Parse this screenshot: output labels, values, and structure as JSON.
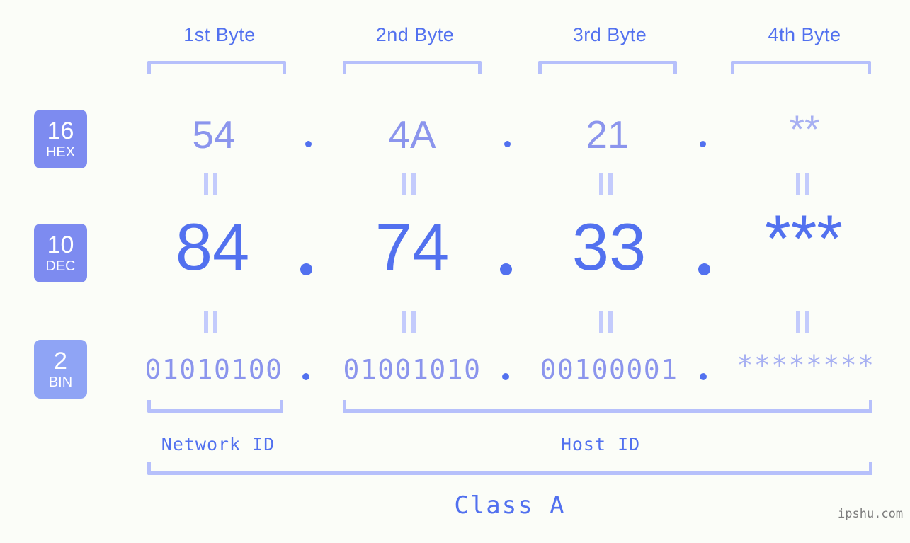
{
  "meta": {
    "background_color": "#fbfdf8",
    "accent_color": "#5271ef",
    "accent_light_color": "#8b95ed",
    "bracket_color": "#b6c0fb",
    "badge_color": "#7d8bf0",
    "badge_color_light": "#8fa4f5",
    "watermark": "ipshu.com"
  },
  "byte_headers": [
    {
      "label": "1st Byte"
    },
    {
      "label": "2nd Byte"
    },
    {
      "label": "3rd Byte"
    },
    {
      "label": "4th Byte"
    }
  ],
  "radix_badges": [
    {
      "number": "16",
      "name": "HEX"
    },
    {
      "number": "10",
      "name": "DEC"
    },
    {
      "number": "2",
      "name": "BIN"
    }
  ],
  "rows": {
    "hex": {
      "values": [
        "54",
        "4A",
        "21",
        "**"
      ],
      "separator": "."
    },
    "dec": {
      "values": [
        "84",
        "74",
        "33",
        "***"
      ],
      "separator": "."
    },
    "bin": {
      "values": [
        "01010100",
        "01001010",
        "00100001",
        "********"
      ],
      "separator": "."
    }
  },
  "equality_marker": "=",
  "id_sections": [
    {
      "label": "Network ID"
    },
    {
      "label": "Host ID"
    }
  ],
  "class_section": {
    "label": "Class A"
  }
}
